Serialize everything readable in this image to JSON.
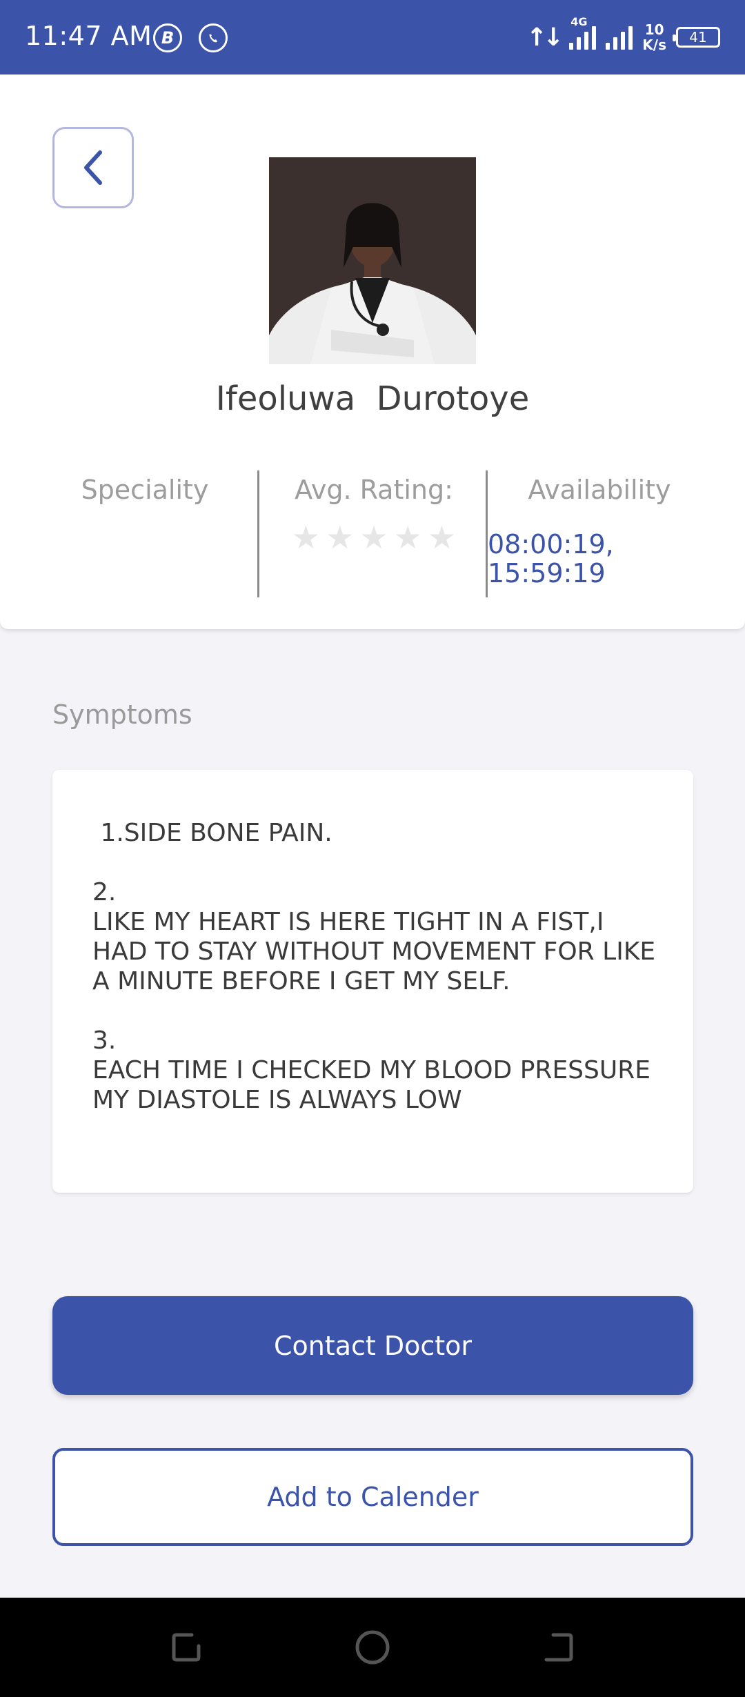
{
  "status_bar": {
    "time": "11:47 AM",
    "app_icons": [
      "b-icon",
      "whatsapp-icon"
    ],
    "network": "4G",
    "speed_value": "10",
    "speed_unit": "K/s",
    "battery": "41"
  },
  "doctor": {
    "name": "Ifeoluwa  Durotoye",
    "speciality_label": "Speciality",
    "speciality_value": "",
    "rating_label": "Avg. Rating:",
    "rating_value": 0,
    "rating_max": 5,
    "availability_label": "Availability",
    "availability_value": "08:00:19, 15:59:19"
  },
  "symptoms": {
    "title": "Symptoms",
    "text": " 1.SIDE BONE PAIN.\n\n2.\nLIKE MY HEART IS HERE TIGHT IN A FIST,I HAD TO STAY WITHOUT MOVEMENT FOR LIKE A MINUTE BEFORE I GET MY SELF.\n\n3.\nEACH TIME I CHECKED MY BLOOD PRESSURE MY DIASTOLE IS ALWAYS LOW"
  },
  "actions": {
    "contact_label": "Contact Doctor",
    "calendar_label": "Add to Calender"
  },
  "colors": {
    "primary": "#3b53a9",
    "background": "#f4f4f8",
    "muted_text": "#9c9c9c"
  }
}
